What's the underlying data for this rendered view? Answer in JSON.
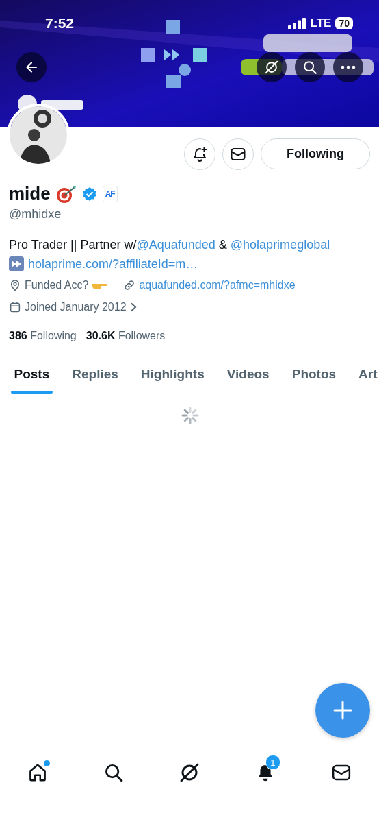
{
  "status_bar": {
    "time": "7:52",
    "network": "LTE",
    "battery": "70"
  },
  "actions": {
    "follow_button": "Following"
  },
  "profile": {
    "name": "mide",
    "handle": "@mhidxe",
    "affiliate_badge": "AF",
    "bio_line_1": [
      {
        "kind": "text",
        "text": "Pro Trader || Partner w/"
      },
      {
        "kind": "link",
        "text": "@Aquafunded"
      },
      {
        "kind": "text",
        "text": " & "
      },
      {
        "kind": "link",
        "text": "@holaprimeglobal"
      }
    ],
    "bio_link": "holaprime.com/?affiliateId=m…",
    "location": "Funded Acc?",
    "website": "aquafunded.com/?afmc=mhidxe",
    "joined": "Joined January 2012"
  },
  "stats": [
    {
      "text": "**386** Following"
    },
    {
      "text": "**30.6K** Followers"
    }
  ],
  "tabs": [
    {
      "label": "Posts",
      "selected": true
    },
    {
      "label": "Replies",
      "selected": false
    },
    {
      "label": "Highlights",
      "selected": false
    },
    {
      "label": "Videos",
      "selected": false
    },
    {
      "label": "Photos",
      "selected": false
    },
    {
      "label": "Art",
      "selected": false
    }
  ],
  "feed": {
    "loading": true
  },
  "nav": [
    {
      "kind": "home",
      "dot": true
    },
    {
      "kind": "search",
      "dot": false
    },
    {
      "kind": "grok",
      "dot": false
    },
    {
      "kind": "notifications",
      "dot": false,
      "badge": "1"
    },
    {
      "kind": "messages",
      "dot": false
    }
  ]
}
